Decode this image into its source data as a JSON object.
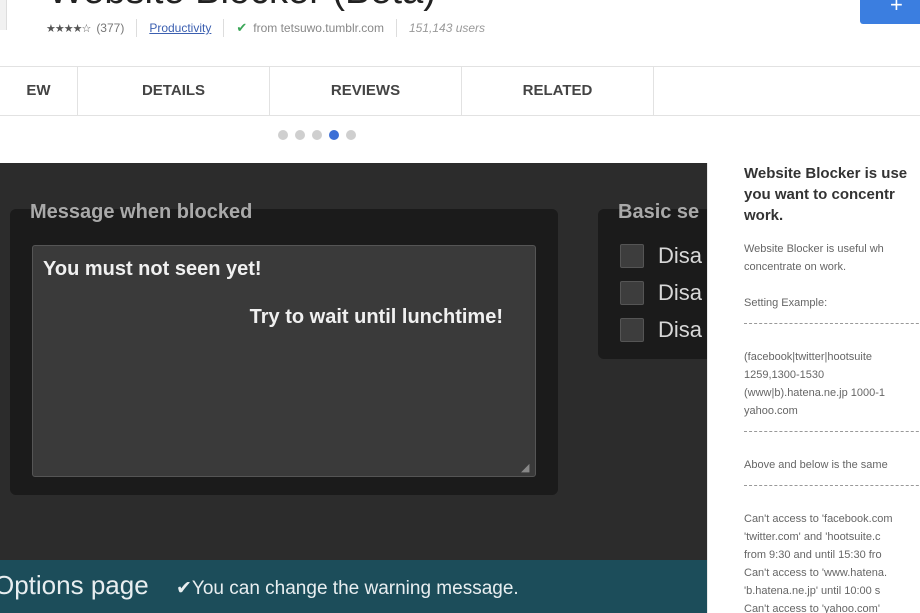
{
  "header": {
    "title": "Website Blocker (Beta)",
    "stars": "★★★★☆",
    "rating_count": "(377)",
    "category": "Productivity",
    "source": "from tetsuwo.tumblr.com",
    "users": "151,143 users",
    "add_button": "+"
  },
  "tabs": [
    {
      "label": "EW"
    },
    {
      "label": "DETAILS"
    },
    {
      "label": "REVIEWS"
    },
    {
      "label": "RELATED"
    }
  ],
  "carousel": {
    "count": 5,
    "active_index": 3
  },
  "screenshot": {
    "message_label": "Message when blocked",
    "message_line1": "You must not seen yet!",
    "message_line2": "Try to wait until lunchtime!",
    "basic_label": "Basic se",
    "options": [
      "Disa",
      "Disa",
      "Disa"
    ],
    "bottom_title": "Options page",
    "bottom_message": "✔You can change the warning message."
  },
  "sidebar": {
    "heading_lines": [
      "Website Blocker is use",
      "you want to concentr",
      "work."
    ],
    "desc_lines": [
      "Website Blocker is useful wh",
      "concentrate on work."
    ],
    "setting_example": "Setting Example:",
    "example_lines": [
      "(facebook|twitter|hootsuite",
      "1259,1300-1530",
      "(www|b).hatena.ne.jp 1000-1",
      "yahoo.com"
    ],
    "above_below": "Above and below is the same",
    "access_lines": [
      "Can't access to 'facebook.com",
      "'twitter.com' and 'hootsuite.c",
      "from 9:30 and until 15:30 fro",
      "Can't access to 'www.hatena.",
      "'b.hatena.ne.jp' until 10:00 s",
      "Can't access to 'yahoo.com'"
    ]
  }
}
